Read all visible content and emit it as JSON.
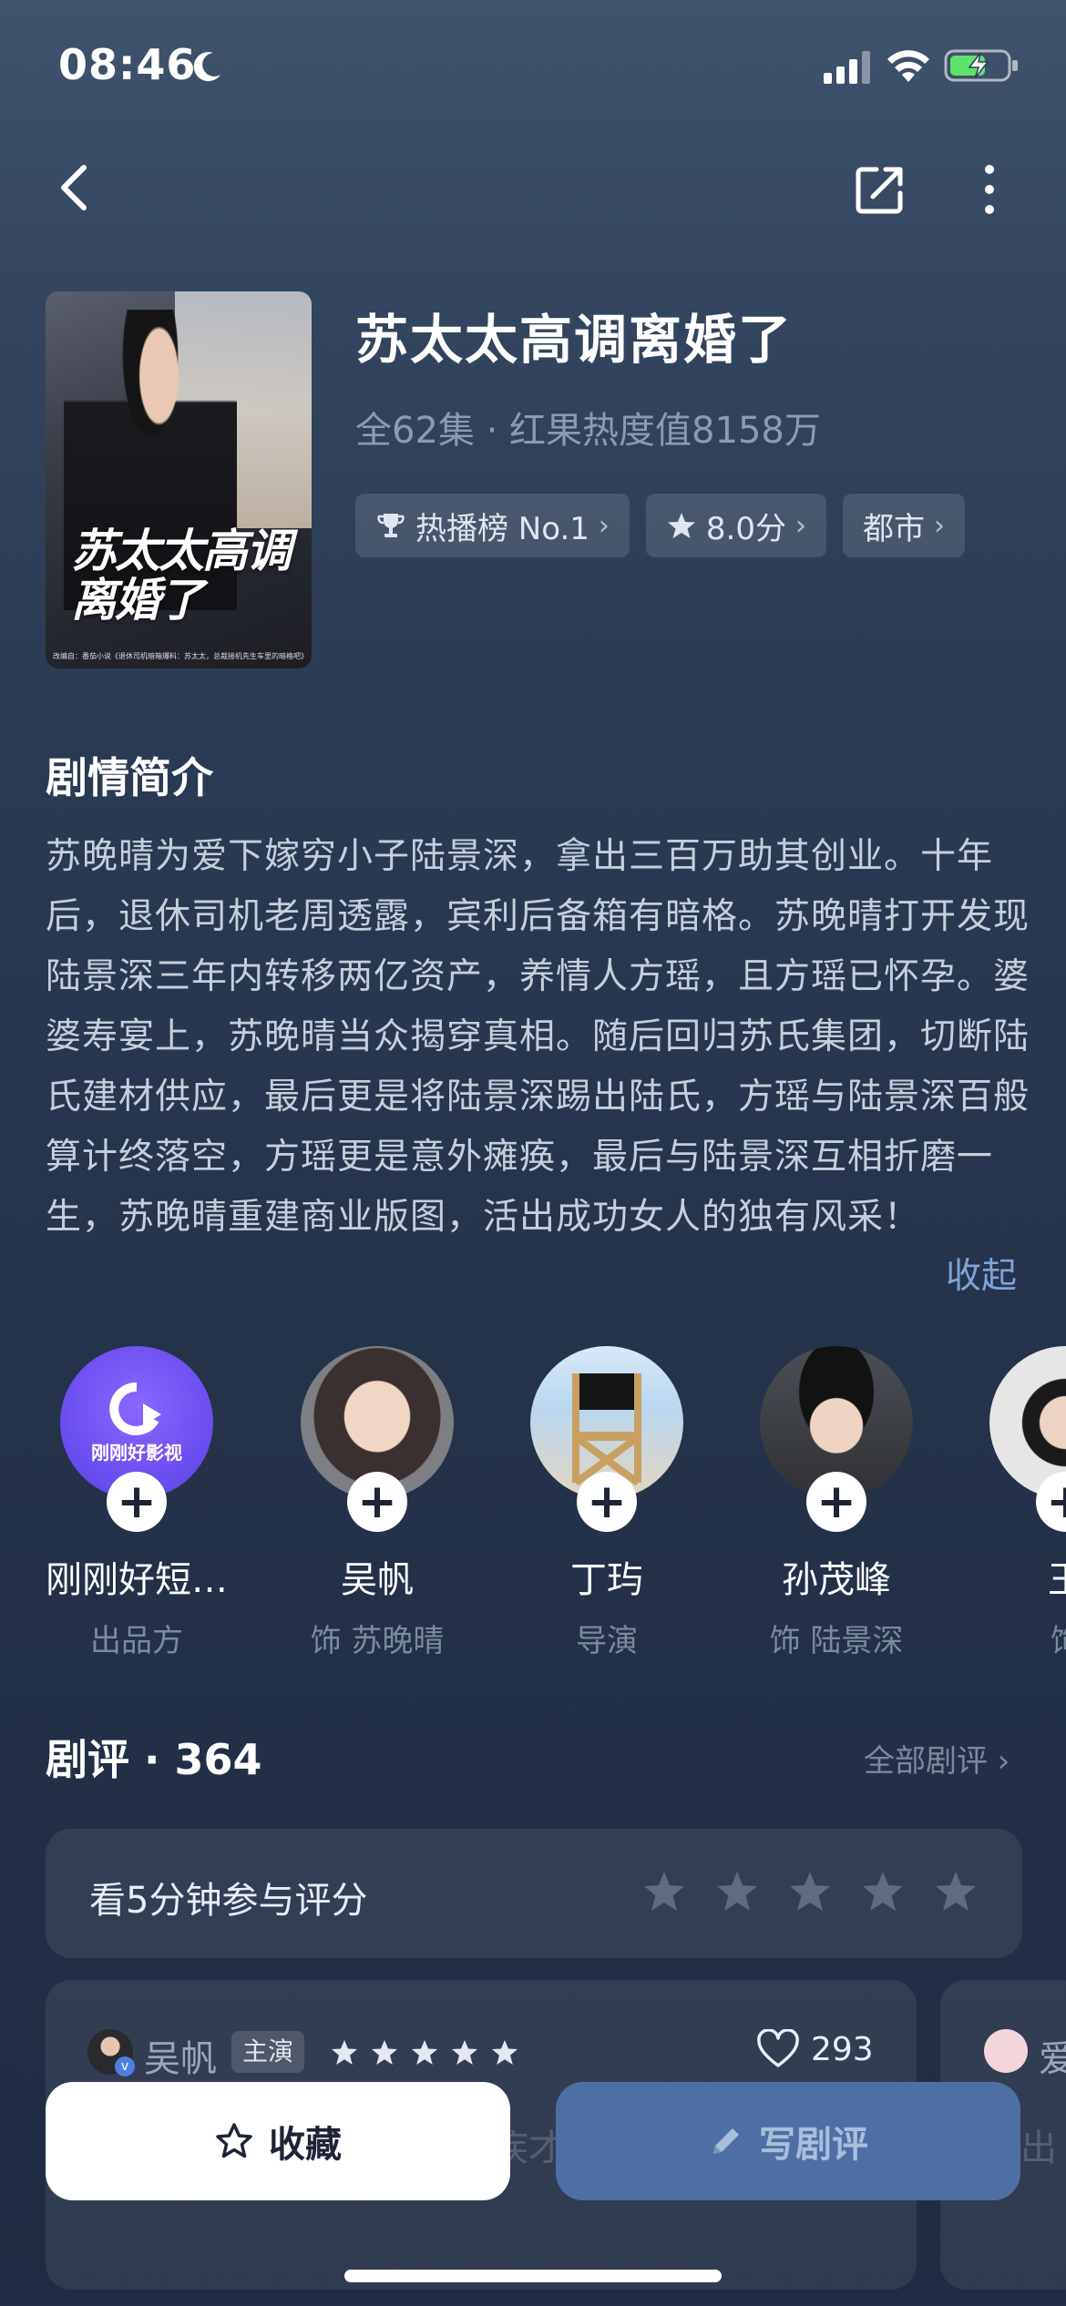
{
  "status_bar": {
    "time": "08:46"
  },
  "drama": {
    "poster_title_art": "苏太太高调离婚了",
    "poster_fine_print": "改编自：番茄小说《退休司机暗箱爆料：苏太太，总裁接机先生车里的暗格吧》",
    "title": "苏太太高调离婚了",
    "meta": "全62集 · 红果热度值8158万",
    "tags": [
      {
        "icon": "trophy-icon",
        "label": "热播榜 No.1"
      },
      {
        "icon": "star-icon",
        "label": "8.0分"
      },
      {
        "icon": "",
        "label": "都市"
      }
    ]
  },
  "synopsis": {
    "section_title": "剧情简介",
    "text": "苏晚晴为爱下嫁穷小子陆景深，拿出三百万助其创业。十年后，退休司机老周透露，宾利后备箱有暗格。苏晚晴打开发现陆景深三年内转移两亿资产，养情人方瑶，且方瑶已怀孕。婆婆寿宴上，苏晚晴当众揭穿真相。随后回归苏氏集团，切断陆氏建材供应，最后更是将陆景深踢出陆氏，方瑶与陆景深百般算计终落空，方瑶更是意外瘫痪，最后与陆景深互相折磨一生，苏晚晴重建商业版图，活出成功女人的独有风采！",
    "collapse_label": "收起"
  },
  "cast": [
    {
      "name": "刚刚好短…",
      "role": "出品方",
      "logo_text": "刚刚好影视"
    },
    {
      "name": "吴帆",
      "role": "饰 苏晚晴"
    },
    {
      "name": "丁玙",
      "role": "导演"
    },
    {
      "name": "孙茂峰",
      "role": "饰 陆景深"
    },
    {
      "name": "王",
      "role": "饰"
    }
  ],
  "reviews": {
    "title": "剧评 · 364",
    "all_label": "全部剧评 ›",
    "rate_prompt": "看5分钟参与评分",
    "first": {
      "user": "吴帆",
      "badge": "主演",
      "verified_mark": "v",
      "likes": "293",
      "rating_stars": 5
    },
    "second": {
      "user": "爱"
    },
    "ghost_text_1": "疾才",
    "ghost_text_2": "出"
  },
  "actions": {
    "favorite_label": "收藏",
    "write_review_label": "写剧评"
  },
  "colors": {
    "accent_link": "#7fa3d6",
    "write_button": "#4e6fa3",
    "background_top": "#40536d",
    "background_bottom": "#1f2b42"
  }
}
